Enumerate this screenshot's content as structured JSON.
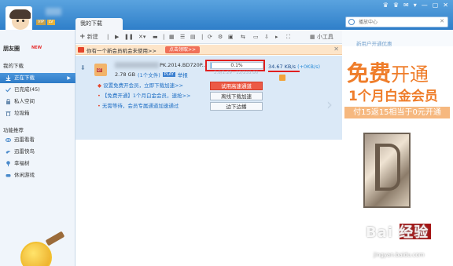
{
  "window": {
    "tab": "我的下载",
    "controls": [
      "♛",
      "♛",
      "✉",
      "▾",
      "—",
      "▢",
      "✕"
    ],
    "user": {
      "vip": "VIP",
      "level": "LV"
    }
  },
  "search": {
    "placeholder": "播放中心",
    "icon": "search-icon"
  },
  "sidebar": {
    "friends": "朋友圈",
    "new_badge": "NEW",
    "my_downloads": "我的下载",
    "items": [
      {
        "label": "正在下载",
        "icon": "download-icon"
      },
      {
        "label": "已完成(45)",
        "icon": "check-icon"
      },
      {
        "label": "私人空间",
        "icon": "lock-icon"
      },
      {
        "label": "垃圾箱",
        "icon": "trash-icon"
      }
    ],
    "featured_title": "功能推荐",
    "featured": [
      {
        "label": "迅雷看看",
        "icon": "eye-icon"
      },
      {
        "label": "迅雷快鸟",
        "icon": "bird-icon"
      },
      {
        "label": "幸福树",
        "icon": "tree-icon"
      },
      {
        "label": "休闲游戏",
        "icon": "gamepad-icon"
      }
    ]
  },
  "toolbar": {
    "new_label": "新建",
    "tools_label": "小工具"
  },
  "promo": {
    "text": "你有一个新会员机会未使用>>",
    "button": "点击领取>>",
    "close": "✕"
  },
  "task": {
    "file_name_tail": "PK.2014.BD720P...",
    "file_type_tag": "BT",
    "size": "2.78 GB",
    "file_count": "(1个文件)",
    "play_tag": "PLAY",
    "report": "举报",
    "progress_label": "0.1%",
    "progress_fraction": 0.001,
    "downloaded": "2.8/1.29 · 12/233.00",
    "speed": "34.67 KB/s",
    "speed_extra": "(+0KB/s)",
    "offers": [
      "设置免费开会员，立即下载加速>>",
      "【免费开通】1个月白金会员，速抢>>",
      "无需等待，会员专属通道加速通过"
    ],
    "buttons": {
      "high_speed": "试用高速通道",
      "offline": "离线下载加速",
      "play": "边下边播"
    }
  },
  "ad": {
    "header": "新用户开通优惠",
    "line1_bold": "免费",
    "line1_light": "开通",
    "line2": "1个月白金会员",
    "line3": "付15返15相当于0元开通",
    "watermark": "Bai 经验",
    "watermark_sub": "jingyan.baidu.com"
  }
}
